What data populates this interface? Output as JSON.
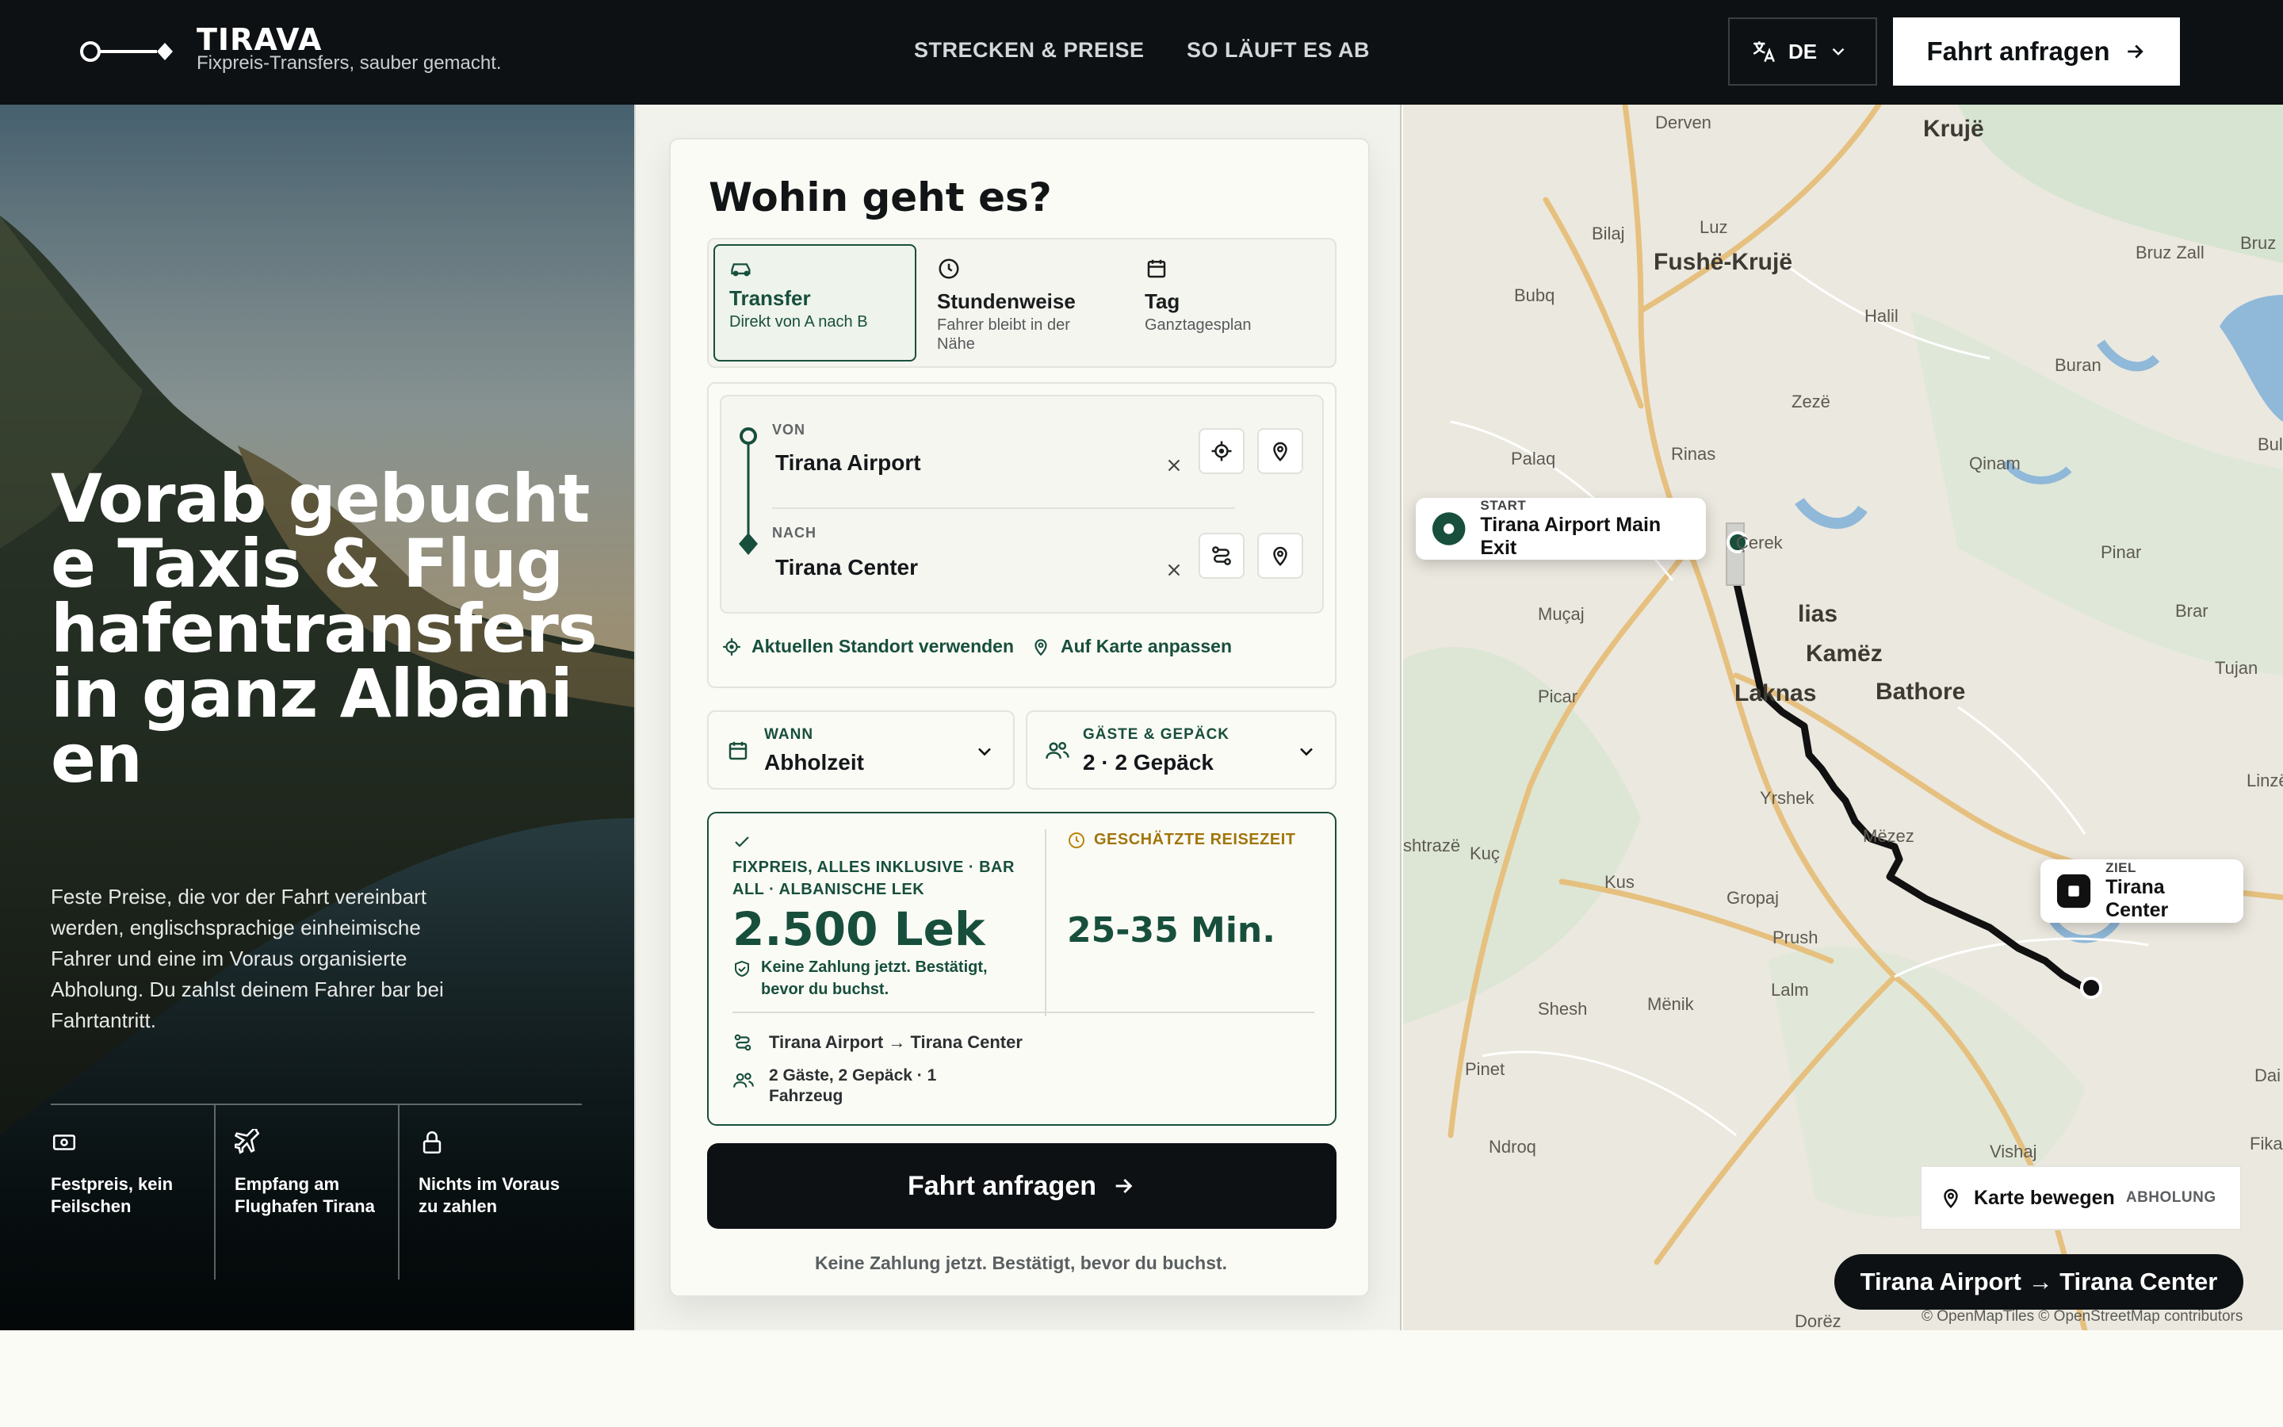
{
  "header": {
    "brand": "TIRAVA",
    "tagline": "Fixpreis-Transfers, sauber gemacht.",
    "nav": [
      "STRECKEN & PREISE",
      "SO LÄUFT ES AB"
    ],
    "lang": "DE",
    "cta": "Fahrt anfragen"
  },
  "hero": {
    "title": "Vorab gebuchte Taxis & Flughafentransfers in ganz Albanien",
    "text": "Feste Preise, die vor der Fahrt vereinbart werden, englischsprachige einheimische Fahrer und eine im Voraus organisierte Abholung. Du zahlst deinem Fahrer bar bei Fahrtantritt.",
    "features": [
      "Festpreis, kein Feilschen",
      "Empfang am Flughafen Tirana",
      "Nichts im Voraus zu zahlen"
    ]
  },
  "form": {
    "title": "Wohin geht es?",
    "modes": [
      {
        "title": "Transfer",
        "sub": "Direkt von A nach B"
      },
      {
        "title": "Stundenweise",
        "sub": "Fahrer bleibt in der Nähe"
      },
      {
        "title": "Tag",
        "sub": "Ganztagesplan"
      }
    ],
    "from_label": "VON",
    "from_value": "Tirana Airport",
    "to_label": "NACH",
    "to_value": "Tirana Center",
    "use_location": "Aktuellen Standort verwenden",
    "fit_map": "Auf Karte anpassen",
    "when_label": "WANN",
    "when_value": "Abholzeit",
    "guests_label": "GÄSTE & GEPÄCK",
    "guests_value": "2 · 2 Gepäck",
    "price_label": "FIXPREIS, ALLES INKLUSIVE · BAR ALL · ALBANISCHE LEK",
    "price_value": "2.500 Lek",
    "price_note": "Keine Zahlung jetzt. Bestätigt, bevor du buchst.",
    "time_label": "GESCHÄTZTE REISEZEIT",
    "time_value": "25-35 Min.",
    "summary_route": "Tirana Airport → Tirana Center",
    "summary_guests": "2 Gäste, 2 Gepäck · 1 Fahrzeug",
    "cta": "Fahrt anfragen",
    "footnote": "Keine Zahlung jetzt. Bestätigt, bevor du buchst."
  },
  "map": {
    "places": [
      "Derven",
      "Krujë",
      "Bilaj",
      "Luz",
      "Fushë-Krujë",
      "Bruz Zall",
      "Bruz",
      "Bubq",
      "Halil",
      "Buran",
      "Zezë",
      "Bule",
      "Palaq",
      "Rinas",
      "Qinam",
      "Çerek",
      "Pinar",
      "Muçaj",
      "lias",
      "Brar",
      "Kamëz",
      "Tujan",
      "Picar",
      "Laknas",
      "Bathore",
      "Linzë",
      "Yrshek",
      "Mëzez",
      "shtrazë",
      "Kuç",
      "Kus",
      "Gropaj",
      "Prush",
      "Lalm",
      "Shesh",
      "Mënik",
      "Pinet",
      "Dai",
      "Ndroq",
      "Vishaj",
      "Fika",
      "Dorëz"
    ],
    "start_label": "START",
    "start_value": "Tirana Airport Main Exit",
    "end_label": "ZIEL",
    "end_value": "Tirana Center",
    "move_label": "Karte bewegen",
    "move_badge": "ABHOLUNG",
    "route_pill": "Tirana Airport → Tirana Center",
    "attribution": "© OpenMapTiles © OpenStreetMap contributors"
  },
  "colors": {
    "accent": "#174f3c",
    "dark": "#0d1113"
  }
}
